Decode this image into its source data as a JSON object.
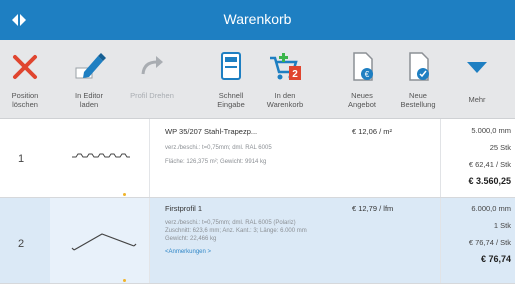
{
  "header": {
    "title": "Warenkorb",
    "nav_icon": "double-chevron-icon",
    "bg_color": "#1e7fc2"
  },
  "toolbar": {
    "buttons": [
      {
        "label": "Position\nlöschen",
        "icon": "delete-x-icon",
        "enabled": true
      },
      {
        "label": "In Editor\nladen",
        "icon": "pencil-icon",
        "enabled": true
      },
      {
        "label": "Profil Drehen",
        "icon": "rotate-arrow-icon",
        "enabled": false
      },
      {
        "label": "Schnell\nEingabe",
        "icon": "calculator-icon",
        "enabled": true
      },
      {
        "label": "In den\nWarenkorb",
        "icon": "cart-add-icon",
        "enabled": true,
        "badge": "2"
      },
      {
        "label": "Neues\nAngebot",
        "icon": "new-offer-icon",
        "enabled": true
      },
      {
        "label": "Neue\nBestellung",
        "icon": "new-order-icon",
        "enabled": true
      },
      {
        "label": "Mehr",
        "icon": "chevron-down-icon",
        "enabled": true
      }
    ]
  },
  "rows": [
    {
      "number": "1",
      "name": "WP 35/207 Stahl-Trapezp...",
      "price_unit": "€ 12,06 / m²",
      "detail_lines": [
        "verz./beschi.: t=0,75mm; dml. RAL 6005",
        "Fläche: 126,375 m²; Gewicht: 9914 kg"
      ],
      "link": "",
      "length": "5.000,0 mm",
      "quantity": "25 Stk",
      "unit_price": "€ 62,41 / Stk",
      "total": "€ 3.560,25"
    },
    {
      "number": "2",
      "name": "Firstprofil 1",
      "price_unit": "€ 12,79 / lfm",
      "detail_lines": [
        "verz./beschi.: t=0,75mm; dml. RAL 6005 (Polariz)",
        "Zuschnitt: 623,6 mm; Anz. Kant.: 3; Länge: 6.000 mm",
        "Gewicht: 22,466 kg"
      ],
      "link": "<Anmerkungen >",
      "length": "6.000,0 mm",
      "quantity": "1 Stk",
      "unit_price": "€ 76,74 / Stk",
      "total": "€ 76,74"
    }
  ]
}
